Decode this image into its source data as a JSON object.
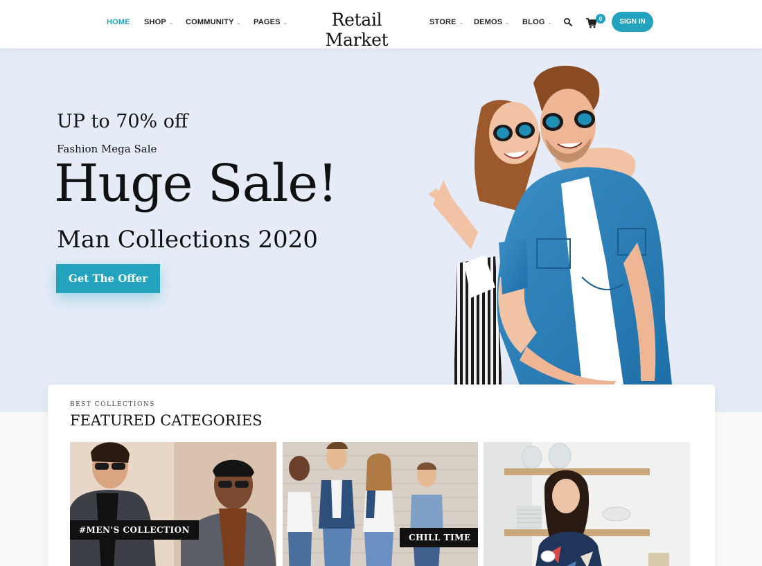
{
  "header": {
    "brand": "Retail Market",
    "nav_left": [
      {
        "label": "HOME",
        "active": true,
        "has_dropdown": false
      },
      {
        "label": "SHOP",
        "active": false,
        "has_dropdown": true
      },
      {
        "label": "COMMUNITY",
        "active": false,
        "has_dropdown": true
      },
      {
        "label": "PAGES",
        "active": false,
        "has_dropdown": true
      }
    ],
    "nav_right": [
      {
        "label": "STORE",
        "active": false,
        "has_dropdown": true
      },
      {
        "label": "DEMOS",
        "active": false,
        "has_dropdown": true
      },
      {
        "label": "BLOG",
        "active": false,
        "has_dropdown": true
      }
    ],
    "search_icon": "search-icon",
    "cart_icon": "cart-icon",
    "cart_count": "0",
    "signin_label": "SIGN IN"
  },
  "hero": {
    "line1": "UP to 70% off",
    "line2": "Fashion Mega Sale",
    "title": "Huge Sale!",
    "line3": "Man Collections 2020",
    "cta_label": "Get The Offer"
  },
  "featured": {
    "eyebrow": "BEST COLLECTIONS",
    "title": "FEATURED CATEGORIES",
    "categories": [
      {
        "label": "#MEN'S COLLECTION"
      },
      {
        "label": "CHILL TIME"
      },
      {
        "label": ""
      }
    ]
  },
  "colors": {
    "accent": "#24a3bf",
    "hero_bg": "#e5ecf7",
    "text": "#111111"
  }
}
